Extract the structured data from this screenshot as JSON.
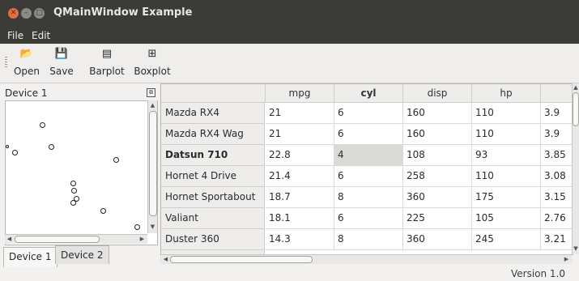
{
  "window": {
    "title": "QMainWindow Example",
    "buttons": [
      "✕",
      "–",
      "□"
    ]
  },
  "menu": {
    "items": [
      "File",
      "Edit"
    ]
  },
  "toolbar": {
    "buttons": [
      {
        "label": "Open",
        "icon": "open-icon",
        "glyph": "📂"
      },
      {
        "label": "Save",
        "icon": "save-icon",
        "glyph": "💾"
      },
      {
        "label": "Barplot",
        "icon": "barplot-icon",
        "glyph": "▤"
      },
      {
        "label": "Boxplot",
        "icon": "boxplot-icon",
        "glyph": "⊞"
      }
    ]
  },
  "dock": {
    "title": "Device 1",
    "float_glyph": "⧉",
    "tabs": [
      "Device 1",
      "Device 2"
    ],
    "active_tab": "Device 1"
  },
  "table": {
    "columns": [
      "mpg",
      "cyl",
      "disp",
      "hp",
      "d"
    ],
    "rows": [
      {
        "name": "Mazda RX4",
        "values": [
          "21",
          "6",
          "160",
          "110",
          "3.9"
        ]
      },
      {
        "name": "Mazda RX4 Wag",
        "values": [
          "21",
          "6",
          "160",
          "110",
          "3.9"
        ]
      },
      {
        "name": "Datsun 710",
        "values": [
          "22.8",
          "4",
          "108",
          "93",
          "3.85"
        ]
      },
      {
        "name": "Hornet 4 Drive",
        "values": [
          "21.4",
          "6",
          "258",
          "110",
          "3.08"
        ]
      },
      {
        "name": "Hornet Sportabout",
        "values": [
          "18.7",
          "8",
          "360",
          "175",
          "3.15"
        ]
      },
      {
        "name": "Valiant",
        "values": [
          "18.1",
          "6",
          "225",
          "105",
          "2.76"
        ]
      },
      {
        "name": "Duster 360",
        "values": [
          "14.3",
          "8",
          "360",
          "245",
          "3.21"
        ]
      }
    ],
    "selected_row": "Datsun 710",
    "selected_column": "cyl"
  },
  "status": {
    "text": "Version 1.0"
  },
  "colors": {
    "titlebar": "#3b3b37",
    "close": "#e86b3e",
    "background": "#f2f1f0"
  }
}
